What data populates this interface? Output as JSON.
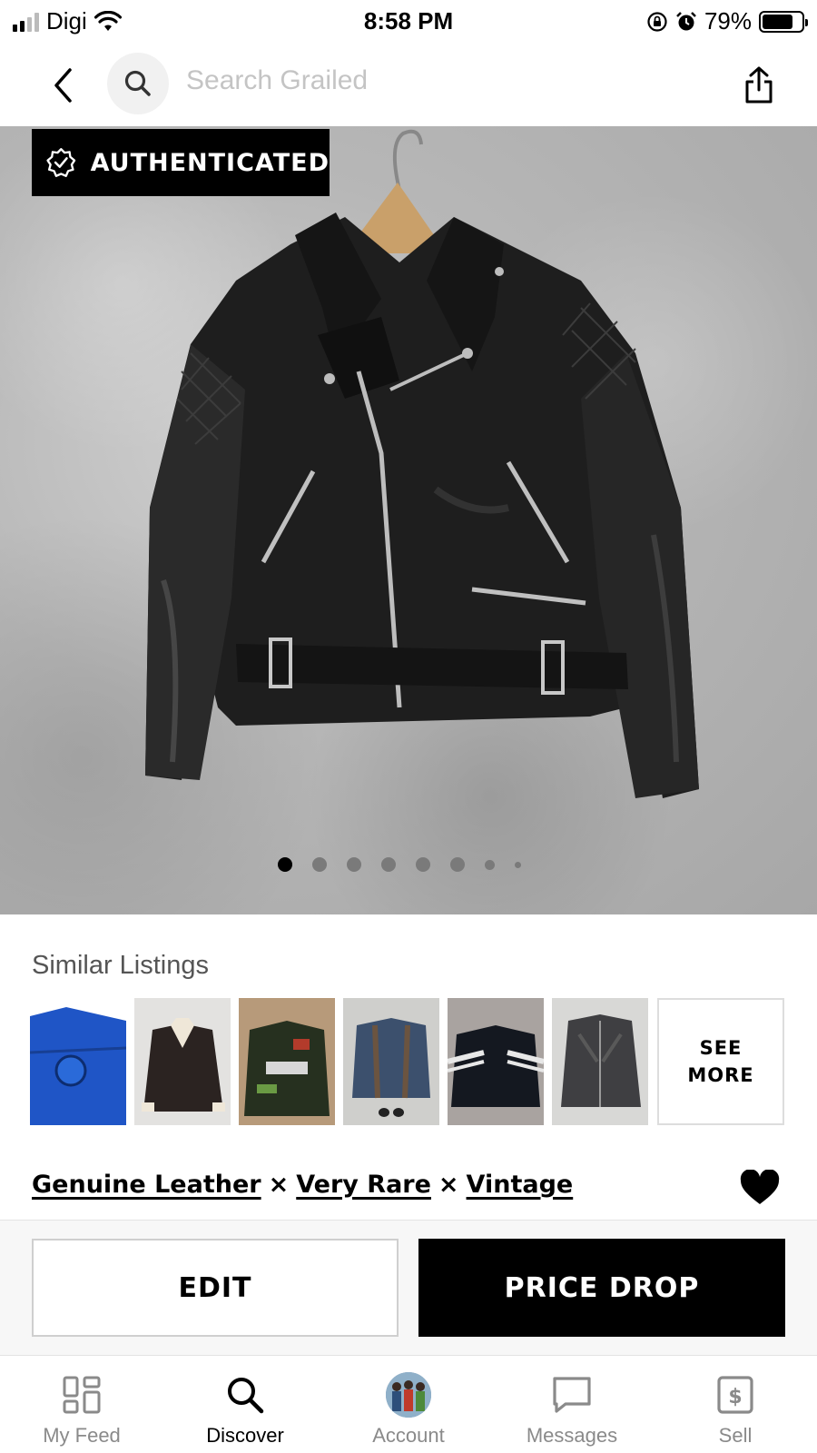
{
  "status_bar": {
    "carrier": "Digi",
    "time": "8:58 PM",
    "battery_percent": "79%",
    "battery_level": 0.79,
    "signal_bars_filled": 2,
    "icons": [
      "signal-icon",
      "wifi-icon",
      "rotation-lock-icon",
      "alarm-icon",
      "battery-icon"
    ]
  },
  "top_nav": {
    "search_placeholder": "Search Grailed",
    "icons": [
      "back-icon",
      "search-icon",
      "share-icon"
    ]
  },
  "hero": {
    "badge_label": "AUTHENTICATED",
    "image_count": 8,
    "active_index": 0
  },
  "similar": {
    "title": "Similar Listings",
    "see_more_line1": "SEE",
    "see_more_line2": "MORE"
  },
  "designers": {
    "items": [
      "Genuine Leather",
      "Very Rare",
      "Vintage"
    ],
    "separator": "×"
  },
  "actions": {
    "edit_label": "EDIT",
    "price_drop_label": "PRICE DROP"
  },
  "tabs": [
    {
      "label": "My Feed",
      "icon": "feed-icon",
      "active": false
    },
    {
      "label": "Discover",
      "icon": "search-icon",
      "active": true
    },
    {
      "label": "Account",
      "icon": "avatar",
      "active": false
    },
    {
      "label": "Messages",
      "icon": "chat-icon",
      "active": false
    },
    {
      "label": "Sell",
      "icon": "dollar-tag-icon",
      "active": false
    }
  ],
  "colors": {
    "accent": "#000000",
    "placeholder": "#c4c4c4",
    "tab_inactive": "#8a8a8a"
  }
}
